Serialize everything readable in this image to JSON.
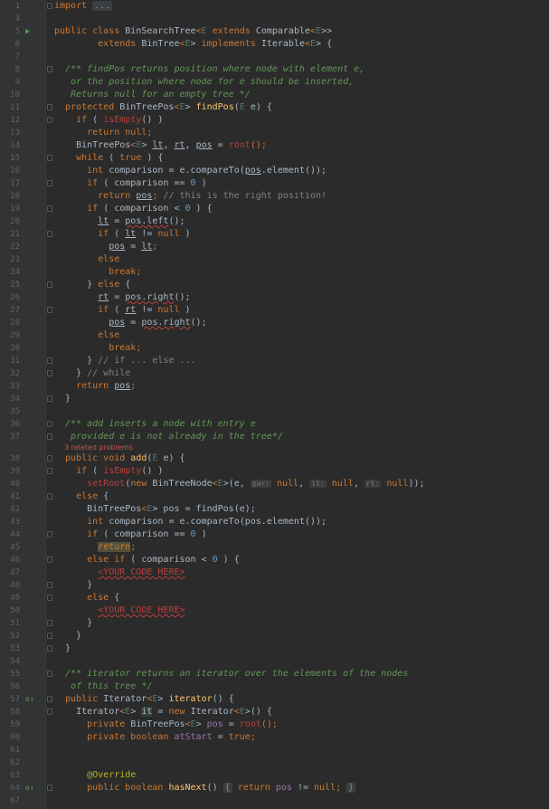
{
  "editor": {
    "lines": [
      {
        "n": "1",
        "fold": "top",
        "tokens": [
          {
            "t": "import ",
            "c": "kw"
          },
          {
            "t": "...",
            "c": "fold-text"
          }
        ]
      },
      {
        "n": "4",
        "tokens": []
      },
      {
        "n": "5",
        "mark": "run",
        "tokens": [
          {
            "t": "public class ",
            "c": "kw"
          },
          {
            "t": "BinSearchTree"
          },
          {
            "t": "<",
            "c": "kw"
          },
          {
            "t": "E",
            "c": "tp"
          },
          {
            "t": " extends ",
            "c": "kw"
          },
          {
            "t": "Comparable"
          },
          {
            "t": "<",
            "c": "kw"
          },
          {
            "t": "E",
            "c": "tp"
          },
          {
            "t": ">>"
          }
        ]
      },
      {
        "n": "6",
        "tokens": [
          {
            "t": "        extends ",
            "c": "kw"
          },
          {
            "t": "BinTree"
          },
          {
            "t": "<",
            "c": "kw"
          },
          {
            "t": "E",
            "c": "tp"
          },
          {
            "t": "> "
          },
          {
            "t": "implements ",
            "c": "kw"
          },
          {
            "t": "Iterable"
          },
          {
            "t": "<",
            "c": "kw"
          },
          {
            "t": "E",
            "c": "tp"
          },
          {
            "t": "> {"
          }
        ]
      },
      {
        "n": "7",
        "tokens": []
      },
      {
        "n": "8",
        "fold": "top",
        "tokens": [
          {
            "t": "  /** findPos returns position where node with element e,",
            "c": "cm"
          }
        ]
      },
      {
        "n": "9",
        "tokens": [
          {
            "t": "   or the position where node for e should be inserted,",
            "c": "cm"
          }
        ]
      },
      {
        "n": "10",
        "tokens": [
          {
            "t": "   Returns null for an empty tree */",
            "c": "cm"
          }
        ]
      },
      {
        "n": "11",
        "fold": "top",
        "tokens": [
          {
            "t": "  protected ",
            "c": "kw"
          },
          {
            "t": "BinTreePos"
          },
          {
            "t": "<",
            "c": "kw"
          },
          {
            "t": "E",
            "c": "tp"
          },
          {
            "t": "> "
          },
          {
            "t": "findPos",
            "c": "fn"
          },
          {
            "t": "("
          },
          {
            "t": "E",
            "c": "tp"
          },
          {
            "t": " e) {"
          }
        ]
      },
      {
        "n": "12",
        "fold": "top",
        "tokens": [
          {
            "t": "    if ",
            "c": "kw"
          },
          {
            "t": "( "
          },
          {
            "t": "isEmpty",
            "c": "er"
          },
          {
            "t": "() )"
          }
        ]
      },
      {
        "n": "13",
        "tokens": [
          {
            "t": "      return null",
            "c": "kw"
          },
          {
            "t": ";",
            "c": "kw"
          }
        ]
      },
      {
        "n": "14",
        "tokens": [
          {
            "t": "    BinTreePos"
          },
          {
            "t": "<",
            "c": "kw"
          },
          {
            "t": "E",
            "c": "tp"
          },
          {
            "t": "> "
          },
          {
            "t": "lt",
            "c": "un"
          },
          {
            "t": ", "
          },
          {
            "t": "rt",
            "c": "un"
          },
          {
            "t": ", "
          },
          {
            "t": "pos",
            "c": "un"
          },
          {
            "t": " = "
          },
          {
            "t": "root",
            "c": "er"
          },
          {
            "t": "();",
            "c": "kw"
          }
        ]
      },
      {
        "n": "15",
        "fold": "top",
        "tokens": [
          {
            "t": "    while ",
            "c": "kw"
          },
          {
            "t": "( "
          },
          {
            "t": "true",
            "c": "kw"
          },
          {
            "t": " ) {"
          }
        ]
      },
      {
        "n": "16",
        "tokens": [
          {
            "t": "      int ",
            "c": "kw"
          },
          {
            "t": "comparison = e.compareTo("
          },
          {
            "t": "pos",
            "c": "un"
          },
          {
            "t": ".element());"
          }
        ]
      },
      {
        "n": "17",
        "fold": "top",
        "tokens": [
          {
            "t": "      if ",
            "c": "kw"
          },
          {
            "t": "( comparison == "
          },
          {
            "t": "0",
            "c": "nm"
          },
          {
            "t": " )"
          }
        ]
      },
      {
        "n": "18",
        "tokens": [
          {
            "t": "        return ",
            "c": "kw"
          },
          {
            "t": "pos",
            "c": "un"
          },
          {
            "t": "; ",
            "c": "kw"
          },
          {
            "t": "// this is the right position!",
            "c": "lc"
          }
        ]
      },
      {
        "n": "19",
        "fold": "top",
        "tokens": [
          {
            "t": "      if ",
            "c": "kw"
          },
          {
            "t": "( comparison < "
          },
          {
            "t": "0",
            "c": "nm"
          },
          {
            "t": " ) {"
          }
        ]
      },
      {
        "n": "20",
        "tokens": [
          {
            "t": "        "
          },
          {
            "t": "lt",
            "c": "un"
          },
          {
            "t": " = "
          },
          {
            "t": "pos.left",
            "c": "wv"
          },
          {
            "t": "();"
          }
        ]
      },
      {
        "n": "21",
        "fold": "top",
        "tokens": [
          {
            "t": "        if ",
            "c": "kw"
          },
          {
            "t": "( "
          },
          {
            "t": "lt",
            "c": "un"
          },
          {
            "t": " != "
          },
          {
            "t": "null",
            "c": "kw"
          },
          {
            "t": " )"
          }
        ]
      },
      {
        "n": "22",
        "tokens": [
          {
            "t": "          "
          },
          {
            "t": "pos",
            "c": "un"
          },
          {
            "t": " = "
          },
          {
            "t": "lt",
            "c": "un"
          },
          {
            "t": ";",
            "c": "kw"
          }
        ]
      },
      {
        "n": "23",
        "tokens": [
          {
            "t": "        else",
            "c": "kw"
          }
        ]
      },
      {
        "n": "24",
        "tokens": [
          {
            "t": "          break",
            "c": "kw"
          },
          {
            "t": ";",
            "c": "kw"
          }
        ]
      },
      {
        "n": "25",
        "fold": "top",
        "tokens": [
          {
            "t": "      } "
          },
          {
            "t": "else ",
            "c": "kw"
          },
          {
            "t": "{"
          }
        ]
      },
      {
        "n": "26",
        "tokens": [
          {
            "t": "        "
          },
          {
            "t": "rt",
            "c": "un"
          },
          {
            "t": " = "
          },
          {
            "t": "pos.right",
            "c": "wv"
          },
          {
            "t": "();"
          }
        ]
      },
      {
        "n": "27",
        "fold": "top",
        "tokens": [
          {
            "t": "        if ",
            "c": "kw"
          },
          {
            "t": "( "
          },
          {
            "t": "rt",
            "c": "un"
          },
          {
            "t": " != "
          },
          {
            "t": "null",
            "c": "kw"
          },
          {
            "t": " )"
          }
        ]
      },
      {
        "n": "28",
        "tokens": [
          {
            "t": "          "
          },
          {
            "t": "pos",
            "c": "un"
          },
          {
            "t": " = "
          },
          {
            "t": "pos.right",
            "c": "wv"
          },
          {
            "t": "();"
          }
        ]
      },
      {
        "n": "29",
        "tokens": [
          {
            "t": "        else",
            "c": "kw"
          }
        ]
      },
      {
        "n": "30",
        "tokens": [
          {
            "t": "          break",
            "c": "kw"
          },
          {
            "t": ";",
            "c": "kw"
          }
        ]
      },
      {
        "n": "31",
        "fold": "bot",
        "tokens": [
          {
            "t": "      } "
          },
          {
            "t": "// if ... else ...",
            "c": "lc"
          }
        ]
      },
      {
        "n": "32",
        "fold": "bot",
        "tokens": [
          {
            "t": "    } "
          },
          {
            "t": "// while",
            "c": "lc"
          }
        ]
      },
      {
        "n": "33",
        "tokens": [
          {
            "t": "    return ",
            "c": "kw"
          },
          {
            "t": "pos",
            "c": "un"
          },
          {
            "t": ";",
            "c": "kw"
          }
        ]
      },
      {
        "n": "34",
        "fold": "bot",
        "tokens": [
          {
            "t": "  }"
          }
        ]
      },
      {
        "n": "35",
        "tokens": []
      },
      {
        "n": "36",
        "fold": "top",
        "tokens": [
          {
            "t": "  /** add inserts a node with entry e",
            "c": "cm"
          }
        ]
      },
      {
        "n": "37",
        "fold": "bot",
        "tokens": [
          {
            "t": "   provided e is not already in the tree*/",
            "c": "cm"
          }
        ]
      },
      {
        "hint": "3 related problems"
      },
      {
        "n": "38",
        "fold": "top",
        "tokens": [
          {
            "t": "  public void ",
            "c": "kw"
          },
          {
            "t": "add",
            "c": "fn"
          },
          {
            "t": "("
          },
          {
            "t": "E",
            "c": "tp"
          },
          {
            "t": " e) {"
          }
        ]
      },
      {
        "n": "39",
        "fold": "top",
        "tokens": [
          {
            "t": "    if ",
            "c": "kw"
          },
          {
            "t": "( "
          },
          {
            "t": "isEmpty",
            "c": "er"
          },
          {
            "t": "() )"
          }
        ]
      },
      {
        "n": "40",
        "tokens": [
          {
            "t": "      "
          },
          {
            "t": "setRoot",
            "c": "er"
          },
          {
            "t": "("
          },
          {
            "t": "new ",
            "c": "kw"
          },
          {
            "t": "BinTreeNode"
          },
          {
            "t": "<",
            "c": "kw"
          },
          {
            "t": "E",
            "c": "tp"
          },
          {
            "t": ">(e, "
          },
          {
            "t": "par:",
            "c": "ph"
          },
          {
            "t": " "
          },
          {
            "t": "null",
            "c": "kw"
          },
          {
            "t": ", "
          },
          {
            "t": "lt:",
            "c": "ph"
          },
          {
            "t": " "
          },
          {
            "t": "null",
            "c": "kw"
          },
          {
            "t": ", "
          },
          {
            "t": "rt:",
            "c": "ph"
          },
          {
            "t": " "
          },
          {
            "t": "null",
            "c": "kw"
          },
          {
            "t": "));"
          }
        ]
      },
      {
        "n": "41",
        "fold": "top",
        "tokens": [
          {
            "t": "    else ",
            "c": "kw"
          },
          {
            "t": "{"
          }
        ]
      },
      {
        "n": "42",
        "tokens": [
          {
            "t": "      BinTreePos"
          },
          {
            "t": "<",
            "c": "kw"
          },
          {
            "t": "E",
            "c": "tp"
          },
          {
            "t": "> pos = findPos(e);"
          }
        ]
      },
      {
        "n": "43",
        "tokens": [
          {
            "t": "      int ",
            "c": "kw"
          },
          {
            "t": "comparison = e.compareTo(pos.element());"
          }
        ]
      },
      {
        "n": "44",
        "fold": "top",
        "tokens": [
          {
            "t": "      if ",
            "c": "kw"
          },
          {
            "t": "( comparison == "
          },
          {
            "t": "0",
            "c": "nm"
          },
          {
            "t": " )"
          }
        ]
      },
      {
        "n": "45",
        "tokens": [
          {
            "t": "        "
          },
          {
            "t": "return",
            "c": "kw hl2"
          },
          {
            "t": ";",
            "c": "kw"
          }
        ]
      },
      {
        "n": "46",
        "fold": "top",
        "tokens": [
          {
            "t": "      else if ",
            "c": "kw"
          },
          {
            "t": "( comparison < "
          },
          {
            "t": "0",
            "c": "nm"
          },
          {
            "t": " ) {"
          }
        ]
      },
      {
        "n": "47",
        "tokens": [
          {
            "t": "        "
          },
          {
            "t": "<YOUR CODE HERE>",
            "c": "er wv"
          }
        ]
      },
      {
        "n": "48",
        "fold": "bot",
        "tokens": [
          {
            "t": "      }"
          }
        ]
      },
      {
        "n": "49",
        "fold": "top",
        "tokens": [
          {
            "t": "      else ",
            "c": "kw"
          },
          {
            "t": "{"
          }
        ]
      },
      {
        "n": "50",
        "tokens": [
          {
            "t": "        "
          },
          {
            "t": "<YOUR CODE HERE>",
            "c": "er wv"
          }
        ]
      },
      {
        "n": "51",
        "fold": "bot",
        "tokens": [
          {
            "t": "      }"
          }
        ]
      },
      {
        "n": "52",
        "fold": "bot",
        "tokens": [
          {
            "t": "    }"
          }
        ]
      },
      {
        "n": "53",
        "fold": "bot",
        "tokens": [
          {
            "t": "  }"
          }
        ]
      },
      {
        "n": "54",
        "tokens": []
      },
      {
        "n": "55",
        "fold": "top",
        "tokens": [
          {
            "t": "  /** iterator returns an iterator over the elements of the nodes",
            "c": "cm"
          }
        ]
      },
      {
        "n": "56",
        "tokens": [
          {
            "t": "   of this tree */",
            "c": "cm"
          }
        ]
      },
      {
        "n": "57",
        "mark": "impl",
        "fold": "top",
        "tokens": [
          {
            "t": "  public ",
            "c": "kw"
          },
          {
            "t": "Iterator"
          },
          {
            "t": "<",
            "c": "kw"
          },
          {
            "t": "E",
            "c": "tp"
          },
          {
            "t": "> "
          },
          {
            "t": "iterator",
            "c": "fn"
          },
          {
            "t": "() {"
          }
        ]
      },
      {
        "n": "58",
        "fold": "top",
        "tokens": [
          {
            "t": "    Iterator"
          },
          {
            "t": "<",
            "c": "kw"
          },
          {
            "t": "E",
            "c": "tp"
          },
          {
            "t": "> "
          },
          {
            "t": "it",
            "c": "hl"
          },
          {
            "t": " = "
          },
          {
            "t": "new ",
            "c": "kw"
          },
          {
            "t": "Iterator"
          },
          {
            "t": "<",
            "c": "kw"
          },
          {
            "t": "E",
            "c": "tp"
          },
          {
            "t": ">() {"
          }
        ]
      },
      {
        "n": "59",
        "tokens": [
          {
            "t": "      private ",
            "c": "kw"
          },
          {
            "t": "BinTreePos"
          },
          {
            "t": "<",
            "c": "kw"
          },
          {
            "t": "E",
            "c": "tp"
          },
          {
            "t": "> "
          },
          {
            "t": "pos",
            "c": "fld"
          },
          {
            "t": " = "
          },
          {
            "t": "root",
            "c": "er"
          },
          {
            "t": "();",
            "c": "kw"
          }
        ]
      },
      {
        "n": "60",
        "tokens": [
          {
            "t": "      private boolean ",
            "c": "kw"
          },
          {
            "t": "atStart",
            "c": "fld"
          },
          {
            "t": " = "
          },
          {
            "t": "true",
            "c": "kw"
          },
          {
            "t": ";",
            "c": "kw"
          }
        ]
      },
      {
        "n": "61",
        "tokens": []
      },
      {
        "n": "62",
        "tokens": []
      },
      {
        "n": "63",
        "tokens": [
          {
            "t": "      @Override",
            "c": "an"
          }
        ]
      },
      {
        "n": "64",
        "mark": "impl",
        "fold": "top",
        "tokens": [
          {
            "t": "      public boolean ",
            "c": "kw"
          },
          {
            "t": "hasNext",
            "c": "fn"
          },
          {
            "t": "() "
          },
          {
            "t": "{",
            "c": "fold-text"
          },
          {
            "t": " return ",
            "c": "kw"
          },
          {
            "t": "pos",
            "c": "fld"
          },
          {
            "t": " != "
          },
          {
            "t": "null",
            "c": "kw"
          },
          {
            "t": ";",
            "c": "kw"
          },
          {
            "t": " "
          },
          {
            "t": "}",
            "c": "fold-text"
          }
        ]
      },
      {
        "n": "67",
        "tokens": []
      }
    ],
    "marks": {
      "run": "▶",
      "impl": "o↑"
    }
  }
}
